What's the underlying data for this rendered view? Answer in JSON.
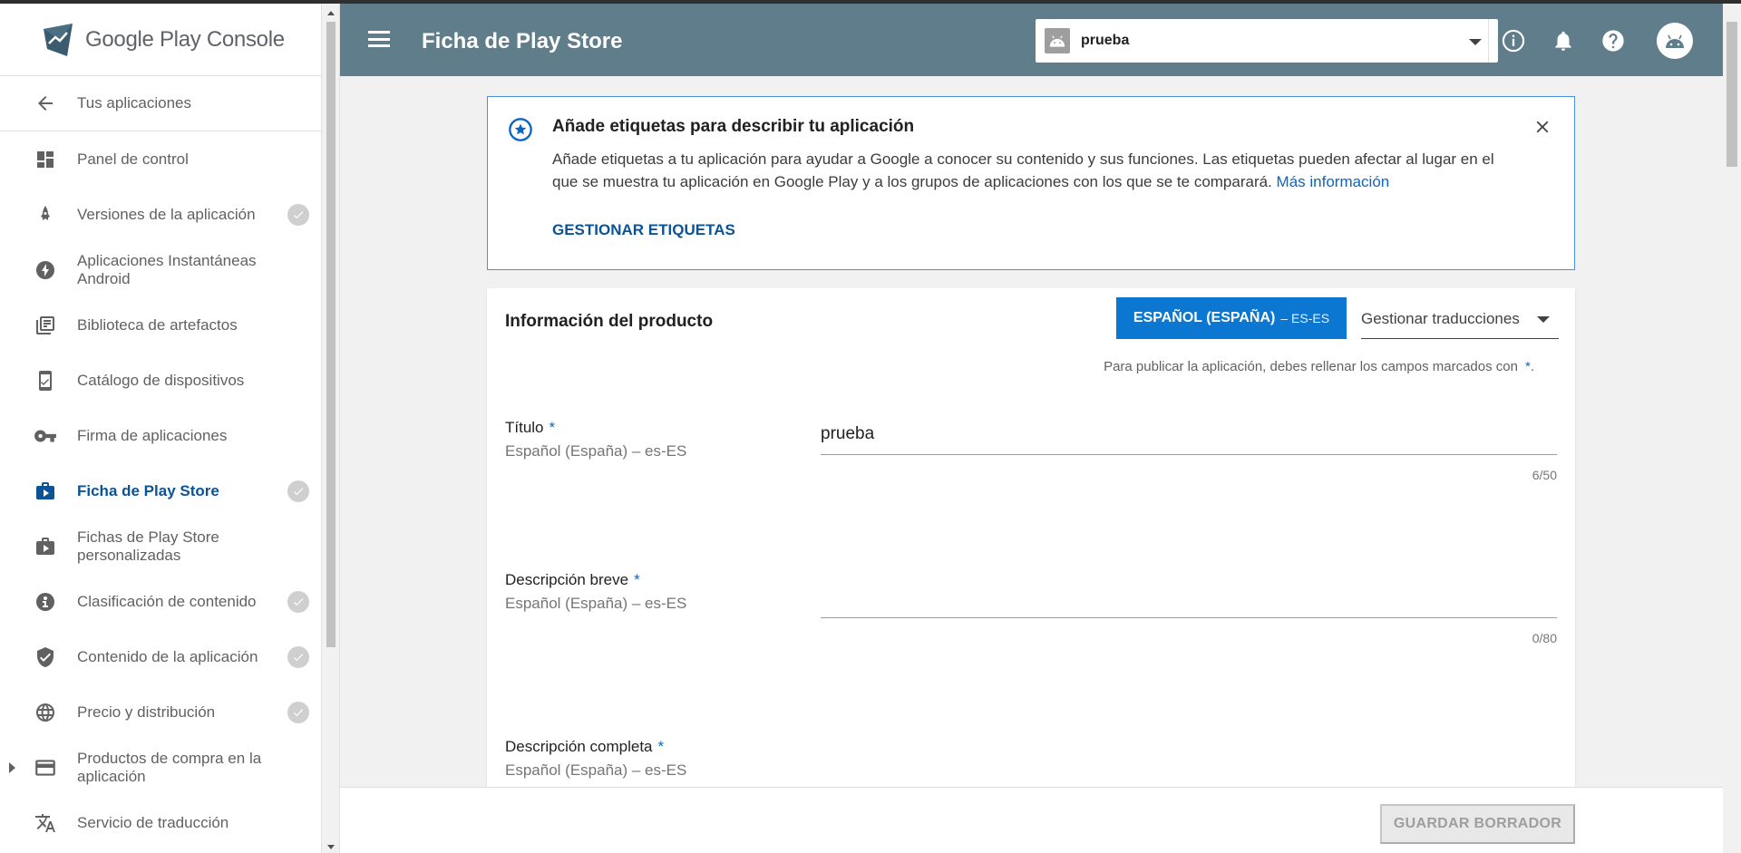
{
  "brand": {
    "logo_text": "Google Play Console"
  },
  "header": {
    "title": "Ficha de Play Store",
    "app_selector": {
      "value": "prueba"
    }
  },
  "sidebar": {
    "back_label": "Tus aplicaciones",
    "items": [
      {
        "label": "Panel de control",
        "icon": "dashboard-icon",
        "checked": false
      },
      {
        "label": "Versiones de la aplicación",
        "icon": "rocket-icon",
        "checked": true
      },
      {
        "label": "Aplicaciones Instantáneas Android",
        "icon": "bolt-icon",
        "checked": false
      },
      {
        "label": "Biblioteca de artefactos",
        "icon": "library-icon",
        "checked": false
      },
      {
        "label": "Catálogo de dispositivos",
        "icon": "device-icon",
        "checked": false
      },
      {
        "label": "Firma de aplicaciones",
        "icon": "key-icon",
        "checked": false
      },
      {
        "label": "Ficha de Play Store",
        "icon": "store-icon",
        "checked": true,
        "active": true
      },
      {
        "label": "Fichas de Play Store personalizadas",
        "icon": "store-custom-icon",
        "checked": false
      },
      {
        "label": "Clasificación de contenido",
        "icon": "rating-icon",
        "checked": true
      },
      {
        "label": "Contenido de la aplicación",
        "icon": "shield-icon",
        "checked": true
      },
      {
        "label": "Precio y distribución",
        "icon": "globe-icon",
        "checked": true
      },
      {
        "label": "Productos de compra en la aplicación",
        "icon": "credit-card-icon",
        "checked": false,
        "expandable": true
      },
      {
        "label": "Servicio de traducción",
        "icon": "translate-icon",
        "checked": false
      }
    ]
  },
  "banner": {
    "title": "Añade etiquetas para describir tu aplicación",
    "text": "Añade etiquetas a tu aplicación para ayudar a Google a conocer su contenido y sus funciones. Las etiquetas pueden afectar al lugar en el que se muestra tu aplicación en Google Play y a los grupos de aplicaciones con los que se te comparará.",
    "link": "Más información",
    "action": "GESTIONAR ETIQUETAS"
  },
  "product_info": {
    "title": "Información del producto",
    "language_button": {
      "label": "ESPAÑOL (ESPAÑA)",
      "code": "– ES-ES"
    },
    "translations_select": "Gestionar traducciones",
    "required_note": "Para publicar la aplicación, debes rellenar los campos marcados con",
    "required_star": "*",
    "required_end": ".",
    "fields": [
      {
        "label": "Título",
        "locale": "Español (España) – es-ES",
        "value": "prueba",
        "count": "6/50"
      },
      {
        "label": "Descripción breve",
        "locale": "Español (España) – es-ES",
        "value": "",
        "count": "0/80"
      },
      {
        "label": "Descripción completa",
        "locale": "Español (España) – es-ES",
        "value": "",
        "count": ""
      }
    ]
  },
  "footer": {
    "save_label": "GUARDAR BORRADOR"
  },
  "colors": {
    "header": "#607d8b",
    "accent": "#0b77d0",
    "link": "#0b66c3",
    "active_nav": "#0b5394"
  }
}
